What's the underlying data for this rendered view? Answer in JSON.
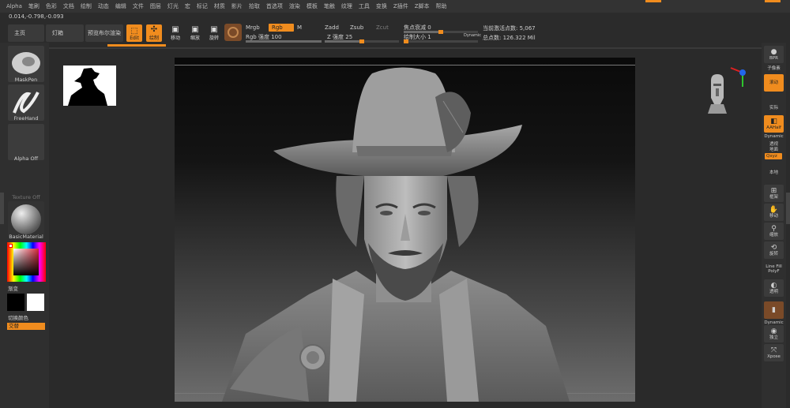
{
  "menu": [
    "Alpha",
    "笔刷",
    "色彩",
    "文档",
    "绘制",
    "动态",
    "编辑",
    "文件",
    "图层",
    "灯光",
    "宏",
    "标记",
    "材质",
    "影片",
    "拾取",
    "首选项",
    "渲染",
    "模板",
    "笔触",
    "纹理",
    "工具",
    "变换",
    "Z插件",
    "Z脚本",
    "帮助"
  ],
  "status": {
    "coords": "0.014,-0.798,-0.093"
  },
  "toolbar": {
    "home": "主页",
    "lightbox": "灯箱",
    "preview_render": "预览布尔渲染",
    "edit": "Edit",
    "draw": "绘制",
    "move": "移动",
    "scale": "缩放",
    "rotate": "旋转",
    "mrgb": "Mrgb",
    "rgb": "Rgb",
    "m": "M",
    "rgb_intensity": "Rgb 强度 100",
    "zadd": "Zadd",
    "zsub": "Zsub",
    "zcut": "Zcut",
    "z_intensity": "Z 强度 25",
    "focal_shift": "焦点衰减 0",
    "draw_size": "绘制大小 1",
    "dynamic": "Dynamic",
    "active_points": "当前激活点数: 5,067",
    "total_points": "总点数: 126.322 Mil"
  },
  "leftpanel": {
    "brush": "MaskPen",
    "stroke": "FreeHand",
    "alpha": "Alpha Off",
    "texture": "Texture Off",
    "material": "BasicMaterial",
    "gradient": "渐变",
    "switch_color": "切换颜色",
    "alternate": "交替"
  },
  "rightpanel": {
    "bpr": "BPR",
    "subpixel": "子像素",
    "scroll": "滚动",
    "zoom": "缩放",
    "actual": "实际",
    "aahalf": "AAHalf",
    "dynamic": "Dynamic",
    "persp": "透视",
    "floor": "地面",
    "local": "本地",
    "xyz": "Qxyz",
    "frame": "框架",
    "move": "移动",
    "zoom3d": "缩放",
    "rotate": "旋转",
    "linefill": "Line Fill",
    "polyf": "PolyF",
    "transp": "透明",
    "ghost": "Dynamic",
    "solo": "独立",
    "xpose": "Xpose"
  },
  "colors": {
    "accent": "#f08c1e",
    "bg": "#2b2b2b",
    "panel": "#2f2f2f"
  }
}
